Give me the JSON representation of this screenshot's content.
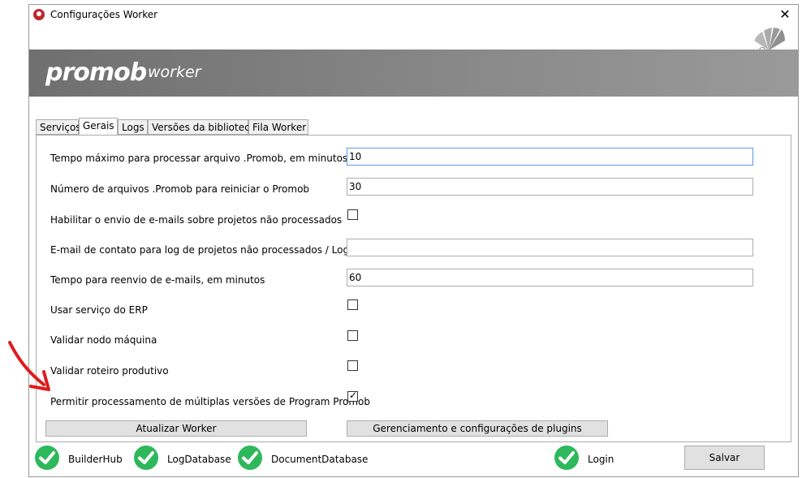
{
  "window": {
    "title": "Configurações Worker",
    "close_glyph": "✕"
  },
  "banner": {
    "logo_main": "promob",
    "logo_sub": "worker"
  },
  "tabs": [
    {
      "label": "Serviços",
      "active": false
    },
    {
      "label": "Gerais",
      "active": true
    },
    {
      "label": "Logs",
      "active": false
    },
    {
      "label": "Versões da biblioteca",
      "active": false
    },
    {
      "label": "Fila Worker",
      "active": false
    }
  ],
  "settings": {
    "max_time": {
      "label": "Tempo máximo para processar arquivo .Promob, em minutos",
      "value": "10"
    },
    "restart_count": {
      "label": "Número de arquivos .Promob para reiniciar o Promob",
      "value": "30"
    },
    "enable_email": {
      "label": "Habilitar o envio de e-mails sobre projetos não processados",
      "checked": false
    },
    "contact_email": {
      "label": "E-mail de contato para log de projetos não processados / Login",
      "value": ""
    },
    "resend_time": {
      "label": "Tempo para reenvio de e-mails, em minutos",
      "value": "60"
    },
    "erp_service": {
      "label": "Usar serviço do ERP",
      "checked": false
    },
    "validate_node": {
      "label": "Validar nodo máquina",
      "checked": false
    },
    "validate_route": {
      "label": "Validar roteiro produtivo",
      "checked": false
    },
    "multi_version": {
      "label": "Permitir processamento de múltiplas versões de Program Promob",
      "checked": true,
      "check_glyph": "✓"
    }
  },
  "buttons": {
    "update_worker": "Atualizar Worker",
    "plugins": "Gerenciamento e configurações de plugins",
    "save": "Salvar"
  },
  "status": [
    {
      "label": "BuilderHub",
      "ok": true
    },
    {
      "label": "LogDatabase",
      "ok": true
    },
    {
      "label": "DocumentDatabase",
      "ok": true
    },
    {
      "label": "Login",
      "ok": true
    }
  ],
  "colors": {
    "status_ok": "#2eb85c",
    "banner": "#7d7d7d",
    "arrow": "#e11b1b"
  }
}
